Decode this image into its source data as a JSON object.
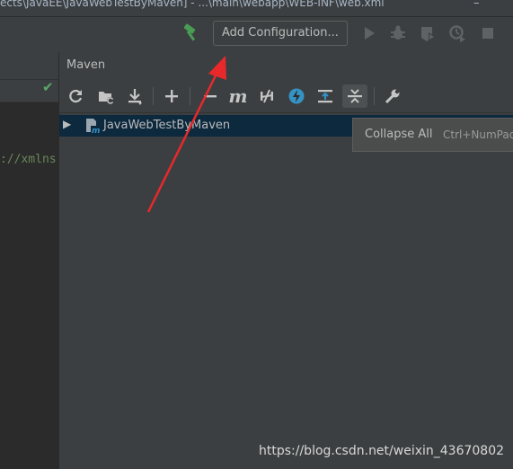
{
  "window": {
    "title": "ects\\JavaEE\\JavaWebTestByMaven] - ...\\main\\webapp\\WEB-INF\\web.xml",
    "close_glyph": "–"
  },
  "toolbar": {
    "build_icon": "hammer-icon",
    "run_config_label": "Add Configuration...",
    "icons": [
      "run-icon",
      "debug-icon",
      "coverage-icon",
      "profile-icon",
      "stop-icon"
    ]
  },
  "editor": {
    "status_check": "✔",
    "code_fragment": "://xmlns"
  },
  "maven": {
    "panel_title": "Maven",
    "toolbar_icons": [
      "reload-icon",
      "generate-sources-icon",
      "download-icon",
      "add-icon",
      "minus-icon",
      "execute-goal-icon",
      "toggle-offline-icon",
      "skip-tests-icon",
      "show-dependencies-icon",
      "collapse-all-icon",
      "settings-wrench-icon"
    ],
    "m_glyph": "m",
    "tree": [
      {
        "label": "JavaWebTestByMaven",
        "expanded": false
      }
    ],
    "tooltip": {
      "label": "Collapse All",
      "shortcut": "Ctrl+NumPad -"
    }
  },
  "watermark": "https://blog.csdn.net/weixin_43670802",
  "colors": {
    "background": "#3c3f41",
    "editor_bg": "#2b2b2b",
    "selection": "#0d293e",
    "accent_blue": "#3592c4",
    "annotation_red": "#e8292b",
    "check_green": "#59a869"
  }
}
